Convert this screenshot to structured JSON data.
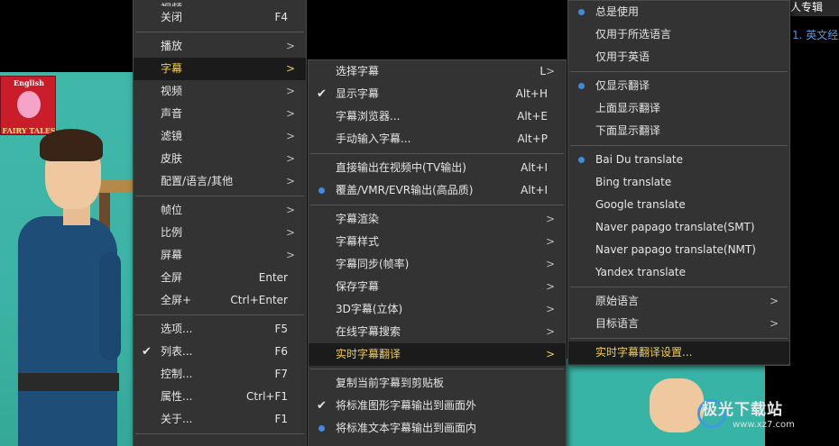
{
  "poster": {
    "top": "English",
    "bottom": "FAIRY TALES"
  },
  "top_right": {
    "tab": "人专辑",
    "link": "1. 英文经"
  },
  "watermark": {
    "main": "极光下载站",
    "sub": "www.xz7.com"
  },
  "menu1": {
    "items": [
      {
        "label": "视频",
        "shortcut": "",
        "submenu": false,
        "partial": true
      },
      {
        "label": "关闭",
        "shortcut": "F4",
        "submenu": false
      },
      {
        "sep": true
      },
      {
        "label": "播放",
        "submenu": true
      },
      {
        "label": "字幕",
        "submenu": true,
        "selected": true
      },
      {
        "label": "视频",
        "submenu": true
      },
      {
        "label": "声音",
        "submenu": true
      },
      {
        "label": "滤镜",
        "submenu": true
      },
      {
        "label": "皮肤",
        "submenu": true
      },
      {
        "label": "配置/语言/其他",
        "submenu": true
      },
      {
        "sep": true
      },
      {
        "label": "帧位",
        "submenu": true
      },
      {
        "label": "比例",
        "submenu": true
      },
      {
        "label": "屏幕",
        "submenu": true
      },
      {
        "label": "全屏",
        "shortcut": "Enter"
      },
      {
        "label": "全屏+",
        "shortcut": "Ctrl+Enter"
      },
      {
        "sep": true
      },
      {
        "label": "选项...",
        "shortcut": "F5"
      },
      {
        "label": "列表...",
        "shortcut": "F6",
        "check": true
      },
      {
        "label": "控制...",
        "shortcut": "F7"
      },
      {
        "label": "属性...",
        "shortcut": "Ctrl+F1"
      },
      {
        "label": "关于...",
        "shortcut": "F1"
      },
      {
        "sep": true
      }
    ]
  },
  "menu2": {
    "items": [
      {
        "label": "选择字幕",
        "shortcut": "L",
        "submenu": true
      },
      {
        "label": "显示字幕",
        "shortcut": "Alt+H",
        "check": true
      },
      {
        "label": "字幕浏览器...",
        "shortcut": "Alt+E"
      },
      {
        "label": "手动输入字幕...",
        "shortcut": "Alt+P"
      },
      {
        "sep": true
      },
      {
        "label": "直接输出在视频中(TV输出)",
        "shortcut": "Alt+I"
      },
      {
        "label": "覆盖/VMR/EVR输出(高品质)",
        "shortcut": "Alt+I",
        "radio": true
      },
      {
        "sep": true
      },
      {
        "label": "字幕渲染",
        "submenu": true
      },
      {
        "label": "字幕样式",
        "submenu": true
      },
      {
        "label": "字幕同步(帧率)",
        "submenu": true
      },
      {
        "label": "保存字幕",
        "submenu": true
      },
      {
        "label": "3D字幕(立体)",
        "submenu": true
      },
      {
        "label": "在线字幕搜索",
        "submenu": true
      },
      {
        "label": "实时字幕翻译",
        "submenu": true,
        "selected": true
      },
      {
        "sep": true
      },
      {
        "label": "复制当前字幕到剪贴板"
      },
      {
        "label": "将标准图形字幕输出到画面外",
        "check": true
      },
      {
        "label": "将标准文本字幕输出到画面内",
        "radio": true
      }
    ]
  },
  "menu3": {
    "items": [
      {
        "label": "总是使用",
        "radio": true
      },
      {
        "label": "仅用于所选语言"
      },
      {
        "label": "仅用于英语"
      },
      {
        "sep": true
      },
      {
        "label": "仅显示翻译",
        "radio": true
      },
      {
        "label": "上面显示翻译"
      },
      {
        "label": "下面显示翻译"
      },
      {
        "sep": true
      },
      {
        "label": "Bai Du translate",
        "radio": true
      },
      {
        "label": "Bing translate"
      },
      {
        "label": "Google translate"
      },
      {
        "label": "Naver papago translate(SMT)"
      },
      {
        "label": "Naver papago translate(NMT)"
      },
      {
        "label": "Yandex translate"
      },
      {
        "sep": true
      },
      {
        "label": "原始语言",
        "submenu": true
      },
      {
        "label": "目标语言",
        "submenu": true
      },
      {
        "sep": true
      },
      {
        "label": "实时字幕翻译设置...",
        "selected": true
      }
    ]
  }
}
